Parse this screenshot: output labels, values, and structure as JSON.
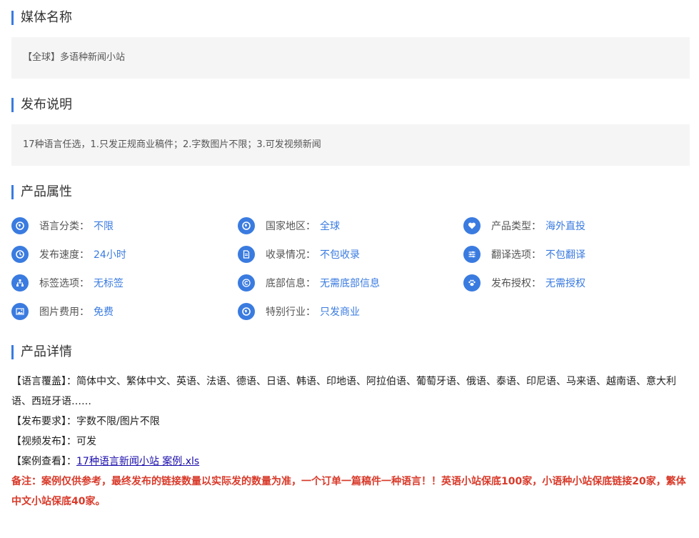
{
  "media": {
    "title": "媒体名称",
    "name": "【全球】多语种新闻小站"
  },
  "publish": {
    "title": "发布说明",
    "desc": "17种语言任选，1.只发正规商业稿件；2.字数图片不限；3.可发视频新闻"
  },
  "attributes": {
    "title": "产品属性",
    "items": [
      {
        "label": "语言分类：",
        "value": "不限",
        "icon": "globe-icon"
      },
      {
        "label": "国家地区：",
        "value": "全球",
        "icon": "globe-icon"
      },
      {
        "label": "产品类型：",
        "value": "海外直投",
        "icon": "heart-icon"
      },
      {
        "label": "发布速度：",
        "value": "24小时",
        "icon": "clock-icon"
      },
      {
        "label": "收录情况：",
        "value": "不包收录",
        "icon": "document-icon"
      },
      {
        "label": "翻译选项：",
        "value": "不包翻译",
        "icon": "sliders-icon"
      },
      {
        "label": "标签选项：",
        "value": "无标签",
        "icon": "sitemap-icon"
      },
      {
        "label": "底部信息：",
        "value": "无需底部信息",
        "icon": "copyright-icon"
      },
      {
        "label": "发布授权：",
        "value": "无需授权",
        "icon": "paw-icon"
      },
      {
        "label": "图片费用：",
        "value": "免费",
        "icon": "image-icon"
      },
      {
        "label": "特别行业：",
        "value": "只发商业",
        "icon": "globe-icon"
      }
    ]
  },
  "details": {
    "title": "产品详情",
    "language_label": "【语言覆盖】：",
    "language_text": "简体中文、繁体中文、英语、法语、德语、日语、韩语、印地语、阿拉伯语、葡萄牙语、俄语、泰语、印尼语、马来语、越南语、意大利语、西班牙语……",
    "requirement_label": "【发布要求】：",
    "requirement_text": "字数不限/图片不限",
    "video_label": "【视频发布】：",
    "video_text": "可发",
    "case_label": "【案例查看】：",
    "case_link": "17种语言新闻小站 案例.xls",
    "note": "备注：案例仅供参考，最终发布的链接数量以实际发的数量为准，一个订单一篇稿件一种语言！！英语小站保底100家，小语种小站保底链接20家，繁体中文小站保底40家。"
  },
  "colors": {
    "accent": "#3a7be0",
    "note": "#d83a2a",
    "box_bg": "#f5f5f5"
  }
}
